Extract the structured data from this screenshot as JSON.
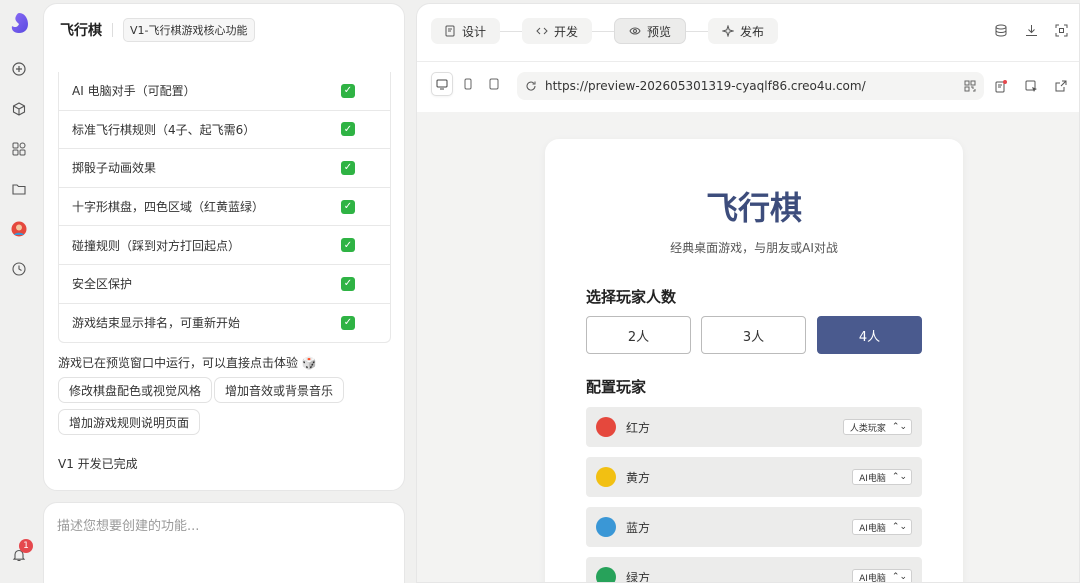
{
  "rail": {
    "icons": [
      "app-logo",
      "new-icon",
      "cube-icon",
      "apps-icon",
      "folder-icon",
      "avatar",
      "history-icon",
      "bell-icon"
    ],
    "notification_count": "1"
  },
  "chat": {
    "title": "飞行棋",
    "version": "V1-飞行棋游戏核心功能",
    "features": [
      {
        "label": "AI 电脑对手（可配置）",
        "status": "✓"
      },
      {
        "label": "标准飞行棋规则（4子、起飞需6）",
        "status": "✓"
      },
      {
        "label": "掷骰子动画效果",
        "status": "✓"
      },
      {
        "label": "十字形棋盘，四色区域（红黄蓝绿）",
        "status": "✓"
      },
      {
        "label": "碰撞规则（踩到对方打回起点）",
        "status": "✓"
      },
      {
        "label": "安全区保护",
        "status": "✓"
      },
      {
        "label": "游戏结束显示排名，可重新开始",
        "status": "✓"
      }
    ],
    "running_text": "游戏已在预览窗口中运行，可以直接点击体验 🎲",
    "suggestions": [
      "修改棋盘配色或视觉风格",
      "增加音效或背景音乐",
      "增加游戏规则说明页面"
    ],
    "done_text": "V1 开发已完成"
  },
  "composer": {
    "placeholder": "描述您想要创建的功能..."
  },
  "workspace": {
    "tabs": [
      {
        "label": "设计",
        "icon": "design-icon"
      },
      {
        "label": "开发",
        "icon": "code-icon"
      },
      {
        "label": "预览",
        "icon": "eye-icon"
      },
      {
        "label": "发布",
        "icon": "sparkle-icon"
      }
    ],
    "active_tab": "预览",
    "url": "https://preview-202605301319-cyaqlf86.creo4u.com/"
  },
  "game": {
    "title": "飞行棋",
    "subtitle": "经典桌面游戏，与朋友或AI对战",
    "player_count_title": "选择玩家人数",
    "player_counts": [
      "2人",
      "3人",
      "4人"
    ],
    "selected_count": "4人",
    "config_title": "配置玩家",
    "players": [
      {
        "name": "红方",
        "color": "#e5483d",
        "type": "人类玩家"
      },
      {
        "name": "黄方",
        "color": "#f2c012",
        "type": "AI电脑"
      },
      {
        "name": "蓝方",
        "color": "#3a97d6",
        "type": "AI电脑"
      },
      {
        "name": "绿方",
        "color": "#27a25a",
        "type": "AI电脑"
      }
    ]
  }
}
